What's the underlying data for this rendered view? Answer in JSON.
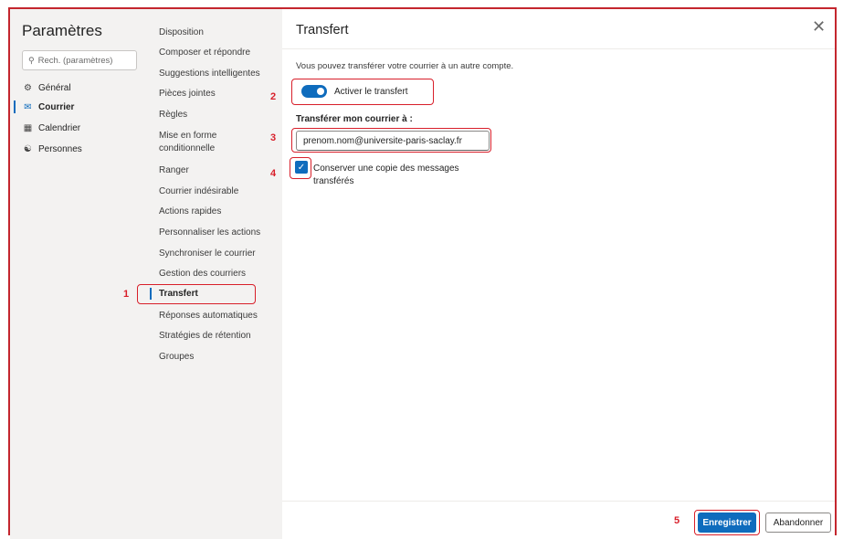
{
  "settings": {
    "title": "Paramètres",
    "search_placeholder": "Rech. (paramètres)"
  },
  "categories": [
    {
      "label": "Général",
      "icon": "gear-icon"
    },
    {
      "label": "Courrier",
      "icon": "mail-icon",
      "active": true
    },
    {
      "label": "Calendrier",
      "icon": "calendar-icon"
    },
    {
      "label": "Personnes",
      "icon": "people-icon"
    }
  ],
  "mail_settings": [
    "Disposition",
    "Composer et répondre",
    "Suggestions intelligentes",
    "Pièces jointes",
    "Règles",
    "Mise en forme",
    "conditionnelle",
    "Ranger",
    "Courrier indésirable",
    "Actions rapides",
    "Personnaliser les actions",
    "Synchroniser le courrier",
    "Gestion des courriers",
    "Transfert",
    "Réponses automatiques",
    "Stratégies de rétention",
    "Groupes"
  ],
  "panel": {
    "title": "Transfert",
    "description": "Vous pouvez transférer votre courrier à un autre compte.",
    "toggle_label": "Activer le transfert",
    "toggle_on": true,
    "forward_label": "Transférer mon courrier à :",
    "forward_value": "prenom.nom@universite-paris-saclay.fr",
    "keep_copy_line1": "Conserver une copie des messages",
    "keep_copy_line2": "transférés",
    "keep_copy_checked": true,
    "save_label": "Enregistrer",
    "cancel_label": "Abandonner"
  },
  "annotations": [
    "1",
    "2",
    "3",
    "4",
    "5"
  ],
  "colors": {
    "accent": "#0f6cbd",
    "annotation": "#d81f2a",
    "sidebar_bg": "#f3f2f1"
  }
}
